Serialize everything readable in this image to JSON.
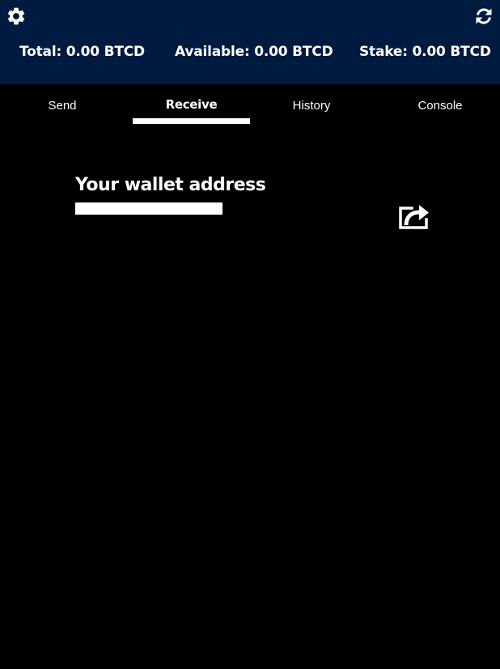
{
  "header": {
    "settings_icon": "gear-icon",
    "refresh_icon": "refresh-icon",
    "background_color": "#011a3f",
    "balances": {
      "total": "Total: 0.00 BTCD",
      "available": "Available: 0.00 BTCD",
      "stake": "Stake: 0.00 BTCD"
    }
  },
  "tabs": [
    {
      "label": "Send",
      "active": false
    },
    {
      "label": "Receive",
      "active": true
    },
    {
      "label": "History",
      "active": false
    },
    {
      "label": "Console",
      "active": false
    }
  ],
  "receive": {
    "title": "Your wallet address",
    "address_value": "",
    "share_icon": "share-icon"
  }
}
